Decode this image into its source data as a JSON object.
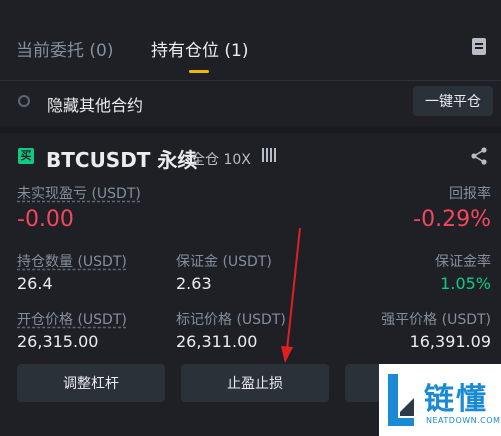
{
  "tabs": {
    "open_orders": "当前委托 (0)",
    "positions": "持有仓位 (1)"
  },
  "filter": {
    "hide_other_label": "隐藏其他合约",
    "close_all_label": "一键平仓"
  },
  "position": {
    "coin_icon_char": "买",
    "symbol": "BTCUSDT 永续",
    "margin_type": "全仓 10X",
    "unrealized_pnl_label": "未实现盈亏 (USDT)",
    "unrealized_pnl_value": "-0.00",
    "roe_label": "回报率",
    "roe_value": "-0.29%",
    "size_label": "持仓数量 (USDT)",
    "size_value": "26.4",
    "margin_label": "保证金 (USDT)",
    "margin_value": "2.63",
    "margin_ratio_label": "保证金率",
    "margin_ratio_value": "1.05%",
    "entry_price_label": "开仓价格 (USDT)",
    "entry_price_value": "26,315.00",
    "mark_price_label": "标记价格 (USDT)",
    "mark_price_value": "26,311.00",
    "liq_price_label": "强平价格 (USDT)",
    "liq_price_value": "16,391.09"
  },
  "actions": {
    "adjust_leverage": "调整杠杆",
    "tp_sl": "止盈止损"
  },
  "watermark": {
    "text": "链懂",
    "sub": "NEATDOWN.COM"
  },
  "colors": {
    "background": "#1e2026",
    "accent": "#f0b90b",
    "negative": "#f6465d",
    "positive": "#0ecb81"
  }
}
